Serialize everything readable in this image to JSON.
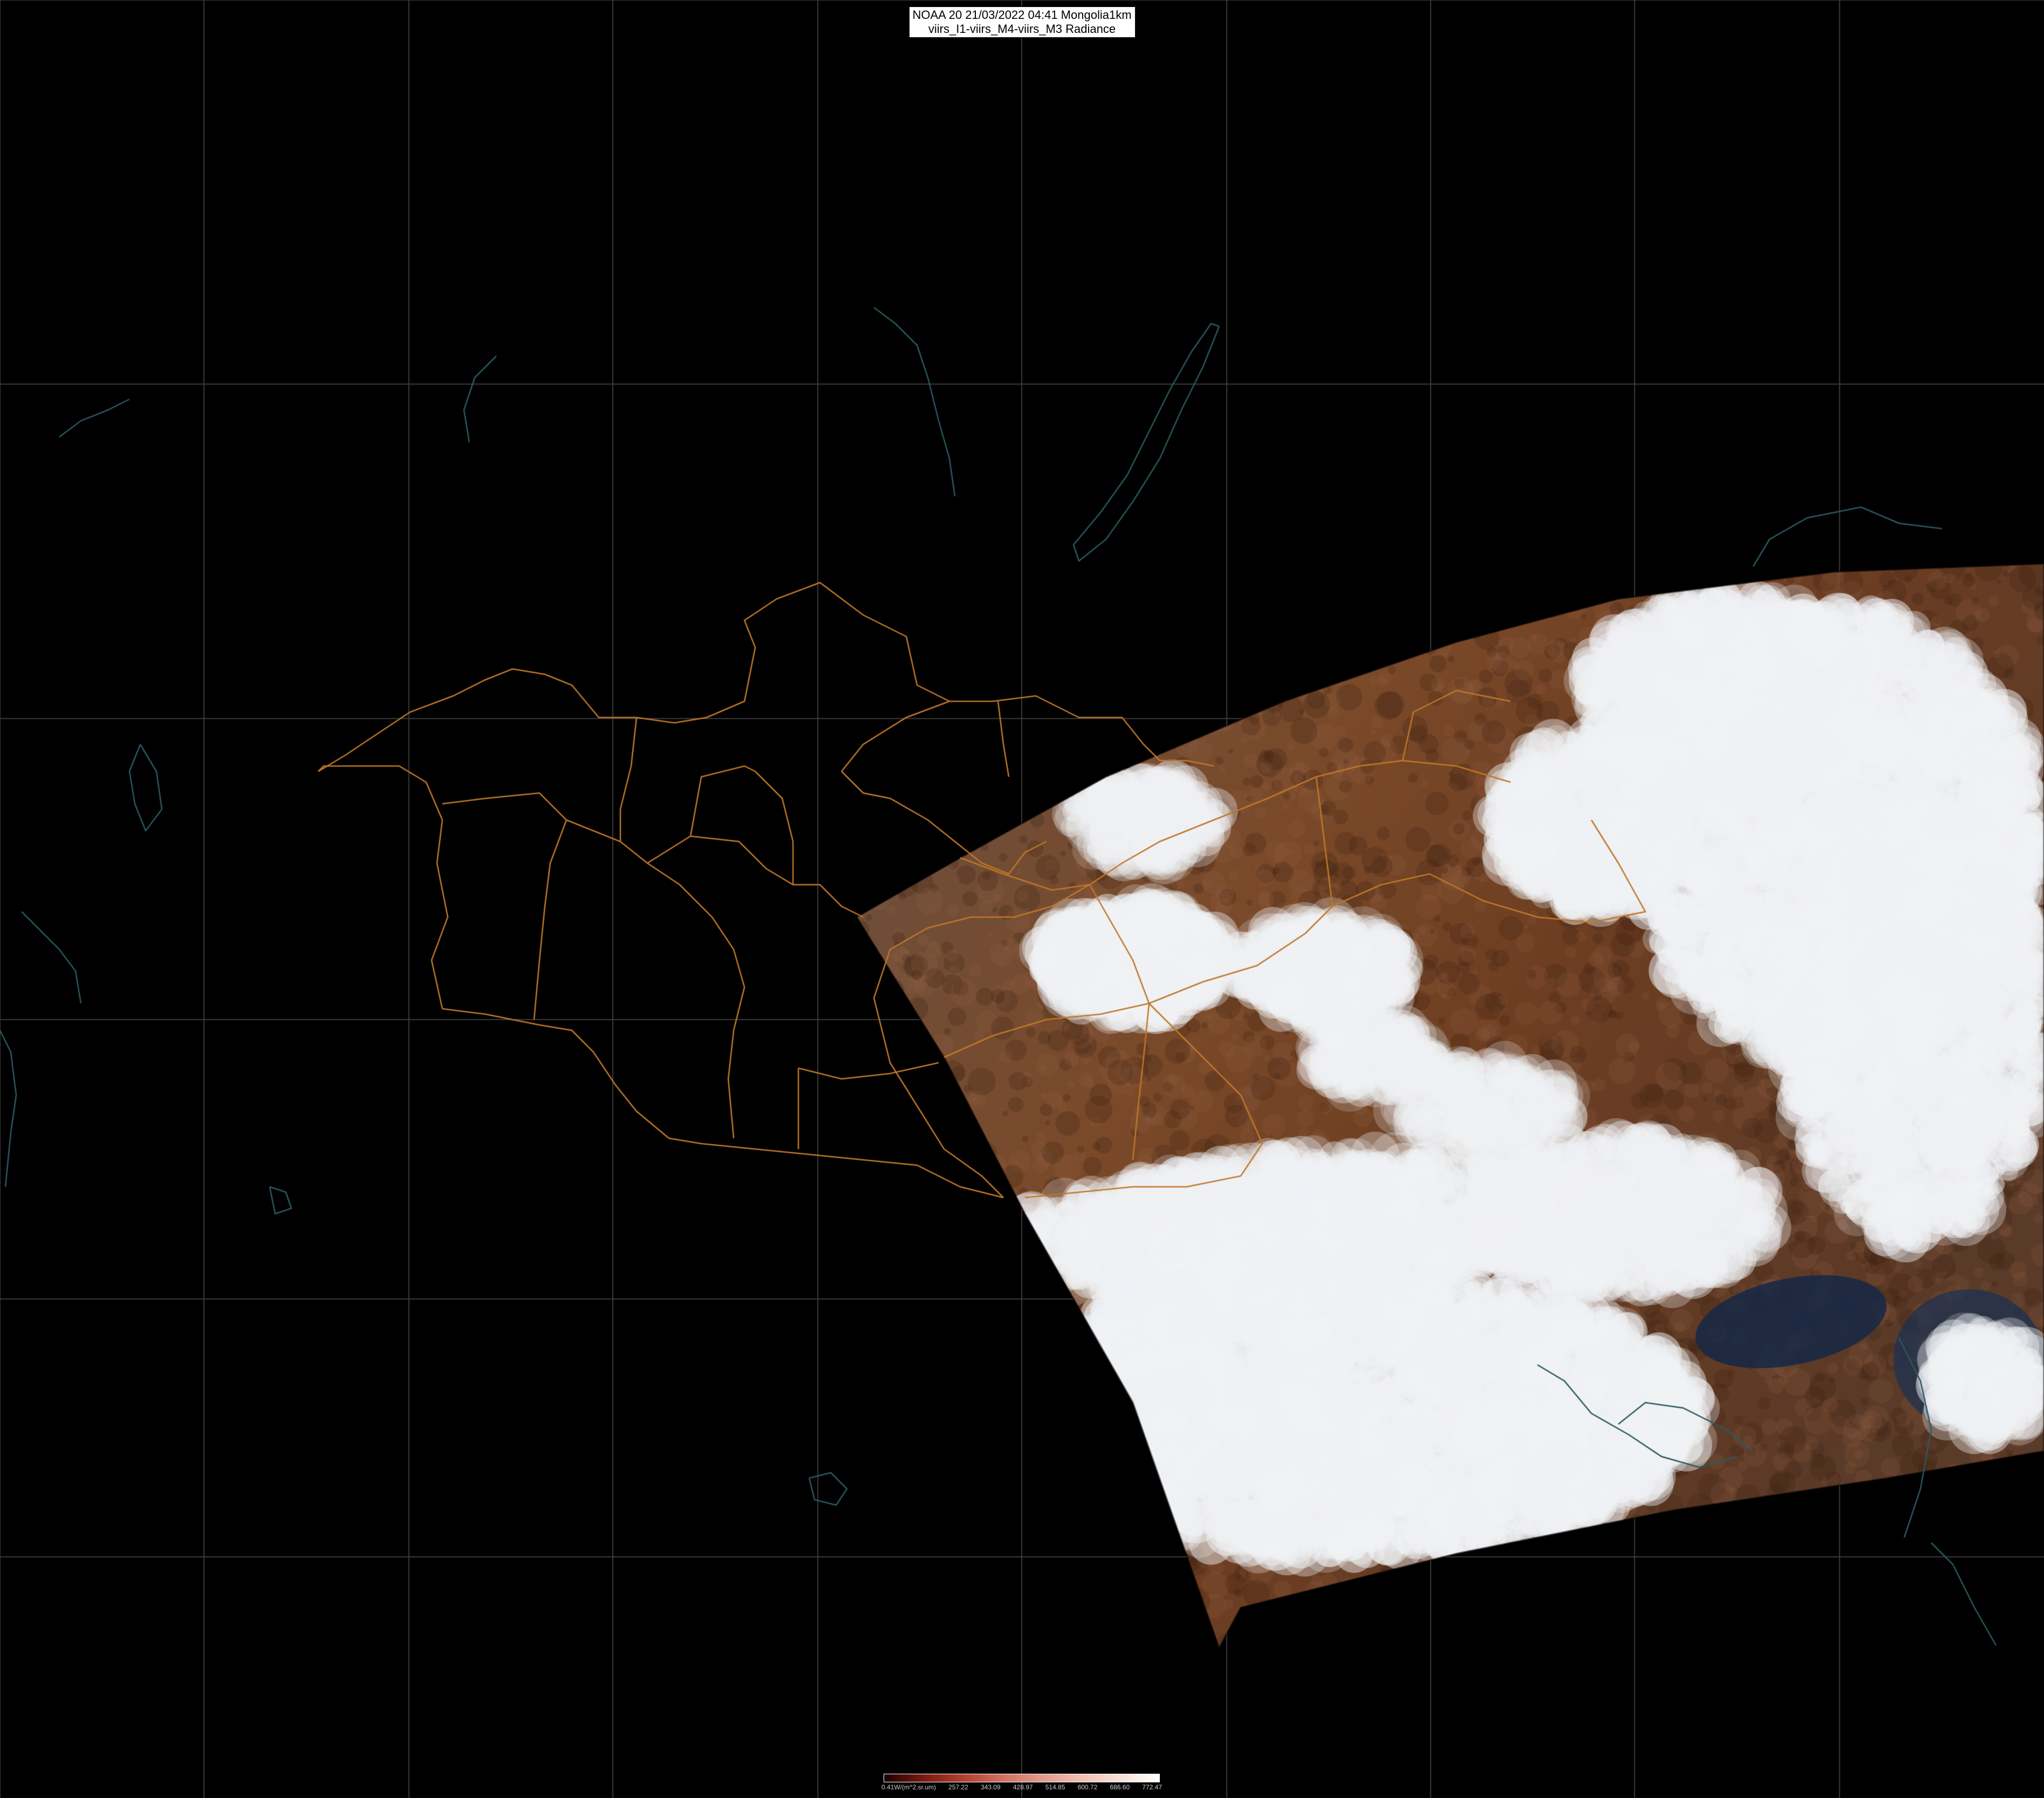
{
  "header": {
    "line1": "NOAA 20 21/03/2022 04:41 Mongolia1km",
    "line2": "viirs_I1-viirs_M4-viirs_M3 Radiance"
  },
  "colorbar": {
    "labels": [
      "0.41W/(m^2.sr.um)",
      "257.22",
      "343.09",
      "428.97",
      "514.85",
      "600.72",
      "686.60",
      "772.47"
    ],
    "colors": [
      "#1a0000",
      "#7a1a10",
      "#b04030",
      "#d07060",
      "#e09a8a",
      "#f0c0b0",
      "#f8e0d8",
      "#ffffff"
    ]
  },
  "map": {
    "background": "#000000",
    "grid_color": "#3a3a3a",
    "border_color": "#c07828",
    "coast_color": "#2a5a60"
  }
}
